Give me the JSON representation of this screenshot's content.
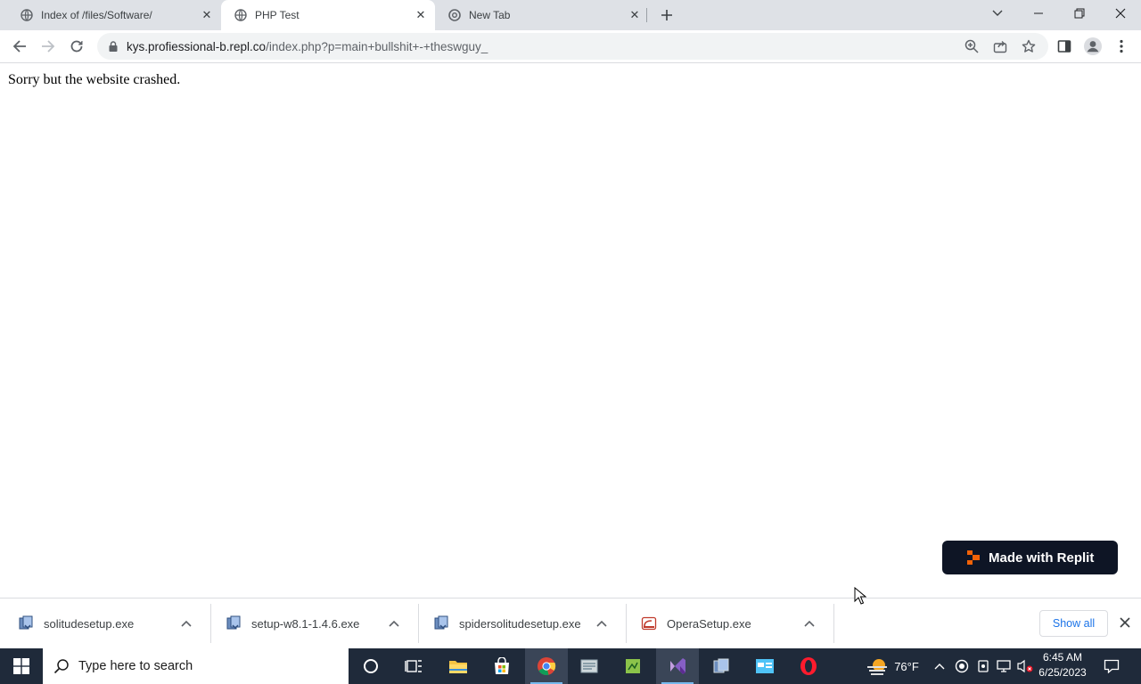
{
  "browser": {
    "tabs": [
      {
        "title": "Index of /files/Software/",
        "active": false
      },
      {
        "title": "PHP Test",
        "active": true
      },
      {
        "title": "New Tab",
        "active": false
      }
    ],
    "omnibox": {
      "domain": "kys.profiessional-b.repl.co",
      "path": "/index.php?p=main+bullshit+-+theswguy_"
    }
  },
  "page": {
    "message": "Sorry but the website crashed.",
    "badge_label": "Made with Replit"
  },
  "downloads": {
    "items": [
      {
        "filename": "solitudesetup.exe",
        "icon": "installer-icon"
      },
      {
        "filename": "setup-w8.1-1.4.6.exe",
        "icon": "installer-icon"
      },
      {
        "filename": "spidersolitudesetup.exe",
        "icon": "installer-icon"
      },
      {
        "filename": "OperaSetup.exe",
        "icon": "opera-installer-icon"
      }
    ],
    "show_all_label": "Show all"
  },
  "taskbar": {
    "search_placeholder": "Type here to search",
    "weather_temp": "76°F",
    "time": "6:45 AM",
    "date": "6/25/2023"
  },
  "colors": {
    "tabstrip_bg": "#dee1e6",
    "taskbar_bg": "#1f2a3a",
    "replit_badge_bg": "#0e1525",
    "replit_orange": "#f26207",
    "link_blue": "#1a73e8"
  }
}
